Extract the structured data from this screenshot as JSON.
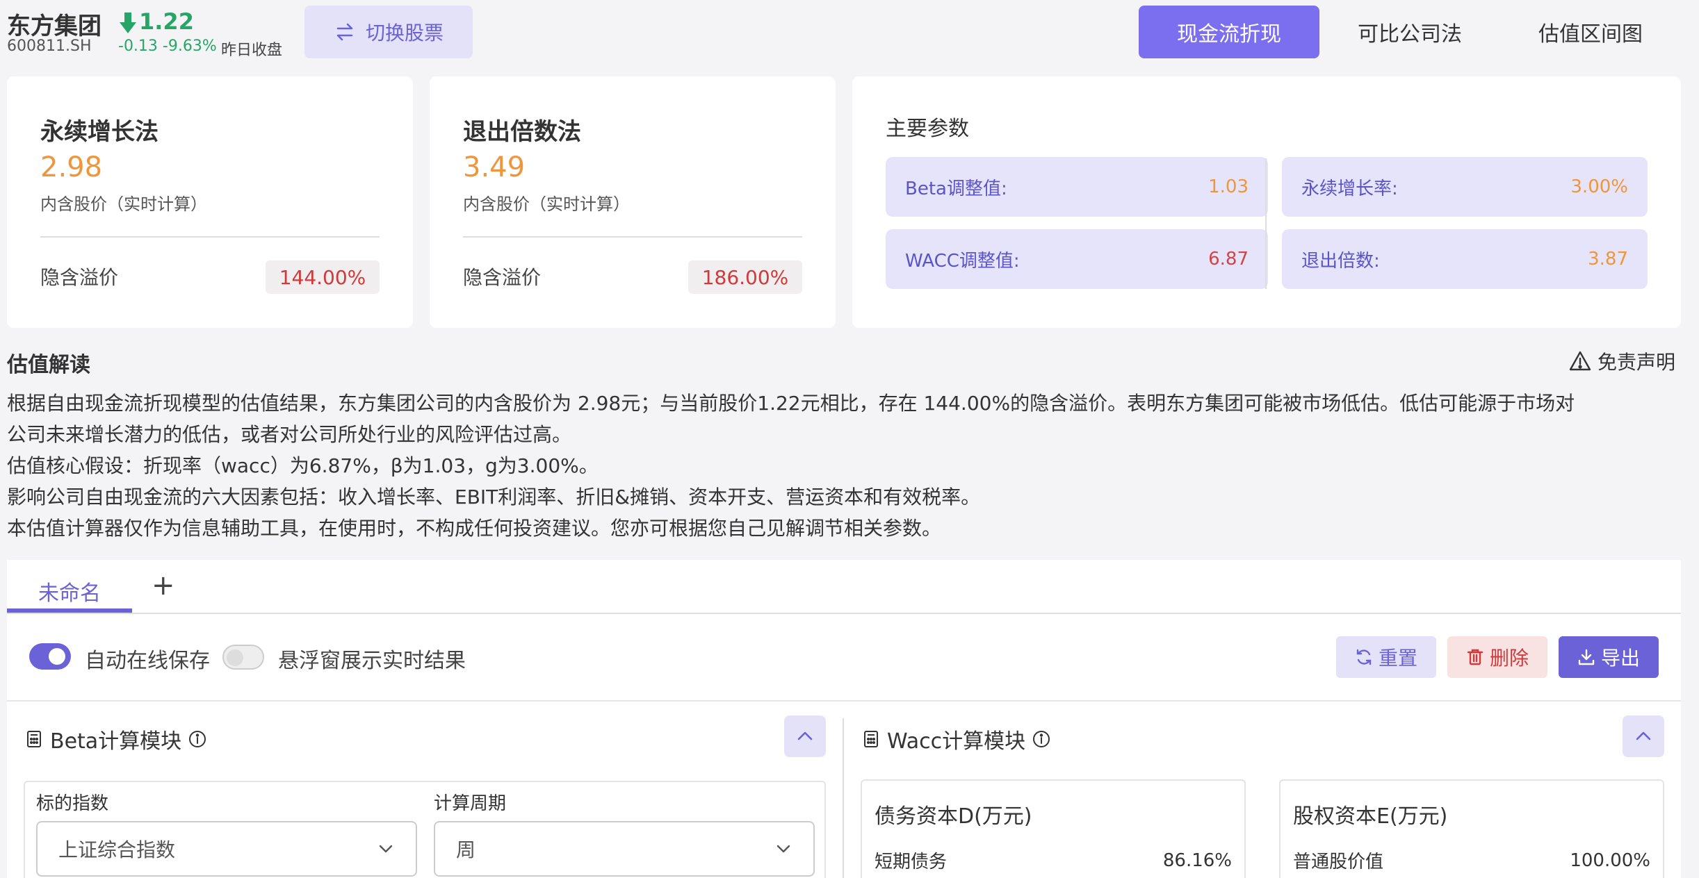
{
  "header": {
    "stock_name": "东方集团",
    "stock_code": "600811.SH",
    "price": "1.22",
    "price_change": "-0.13 -9.63%",
    "price_note": "昨日收盘",
    "switch_label": "切换股票",
    "tabs": [
      {
        "label": "现金流折现",
        "active": true
      },
      {
        "label": "可比公司法",
        "active": false
      },
      {
        "label": "估值区间图",
        "active": false
      }
    ]
  },
  "perpetual": {
    "title": "永续增长法",
    "value": "2.98",
    "subtitle": "内含股价（实时计算）",
    "premium_label": "隐含溢价",
    "premium": "144.00%"
  },
  "exit_multiple": {
    "title": "退出倍数法",
    "value": "3.49",
    "subtitle": "内含股价（实时计算）",
    "premium_label": "隐含溢价",
    "premium": "186.00%"
  },
  "params": {
    "title": "主要参数",
    "items": [
      {
        "label": "Beta调整值:",
        "value": "1.03"
      },
      {
        "label": "WACC调整值:",
        "value": "6.87"
      },
      {
        "label": "永续增长率:",
        "value": "3.00%"
      },
      {
        "label": "退出倍数:",
        "value": "3.87"
      }
    ]
  },
  "interpretation": {
    "title": "估值解读",
    "disclaimer": "免责声明",
    "lines": [
      "根据自由现金流折现模型的估值结果，东方集团公司的内含股价为 2.98元；与当前股价1.22元相比，存在 144.00%的隐含溢价。表明东方集团可能被市场低估。低估可能源于市场对",
      "公司未来增长潜力的低估，或者对公司所处行业的风险评估过高。",
      "估值核心假设：折现率（wacc）为6.87%，β为1.03，g为3.00%。",
      "影响公司自由现金流的六大因素包括：收入增长率、EBIT利润率、折旧&摊销、资本开支、营运资本和有效税率。",
      "本估值计算器仅作为信息辅助工具，在使用时，不构成任何投资建议。您亦可根据您自己见解调节相关参数。"
    ]
  },
  "calculator": {
    "tab_label": "未命名",
    "add_tab": "+",
    "auto_save_label": "自动在线保存",
    "float_label": "悬浮窗展示实时结果",
    "auto_save_on": true,
    "float_on": false,
    "reset_label": "重置",
    "delete_label": "删除",
    "export_label": "导出"
  },
  "beta_module": {
    "title": "Beta计算模块",
    "index_label": "标的指数",
    "index_value": "上证综合指数",
    "period_label": "计算周期",
    "period_value": "周"
  },
  "wacc_module": {
    "title": "Wacc计算模块",
    "debt_title": "债务资本D(万元)",
    "debt_row_label": "短期债务",
    "debt_row_value": "86.16%",
    "equity_title": "股权资本E(万元)",
    "equity_row_label": "普通股价值",
    "equity_row_value": "100.00%"
  },
  "colors": {
    "accent": "#6a62d6",
    "price_down": "#27a567",
    "value_orange": "#f0963a",
    "premium_red": "#d03a3a"
  }
}
